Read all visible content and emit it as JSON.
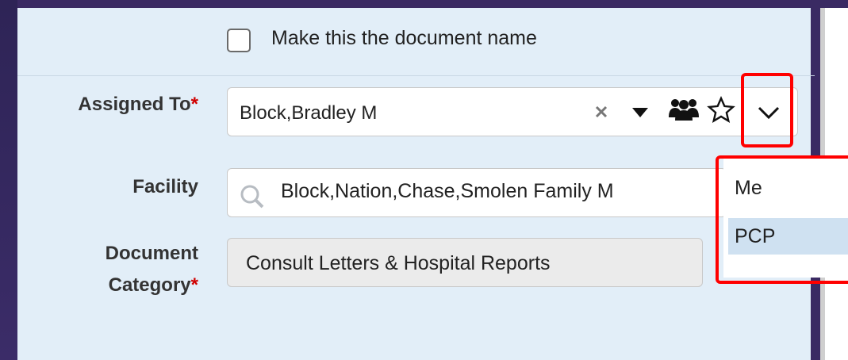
{
  "checkbox": {
    "label": "Make this the document name",
    "checked": false
  },
  "assigned_to": {
    "label": "Assigned To",
    "required_mark": "*",
    "value": "Block,Bradley M"
  },
  "facility": {
    "label": "Facility",
    "value": "Block,Nation,Chase,Smolen Family M"
  },
  "document_category": {
    "label_line1": "Document",
    "label_line2": "Category",
    "required_mark": "*",
    "value": "Consult Letters & Hospital Reports"
  },
  "dropdown_menu": {
    "items": [
      "Me",
      "PCP"
    ],
    "highlighted": "PCP"
  },
  "colors": {
    "highlight_box": "#ff0000",
    "panel_bg": "#e2eef8",
    "required": "#d00000",
    "selected_item": "#cfe1f1"
  },
  "icons": [
    "clear-icon",
    "caret-down-icon",
    "group-icon",
    "star-icon",
    "chevron-down-icon",
    "search-icon"
  ]
}
